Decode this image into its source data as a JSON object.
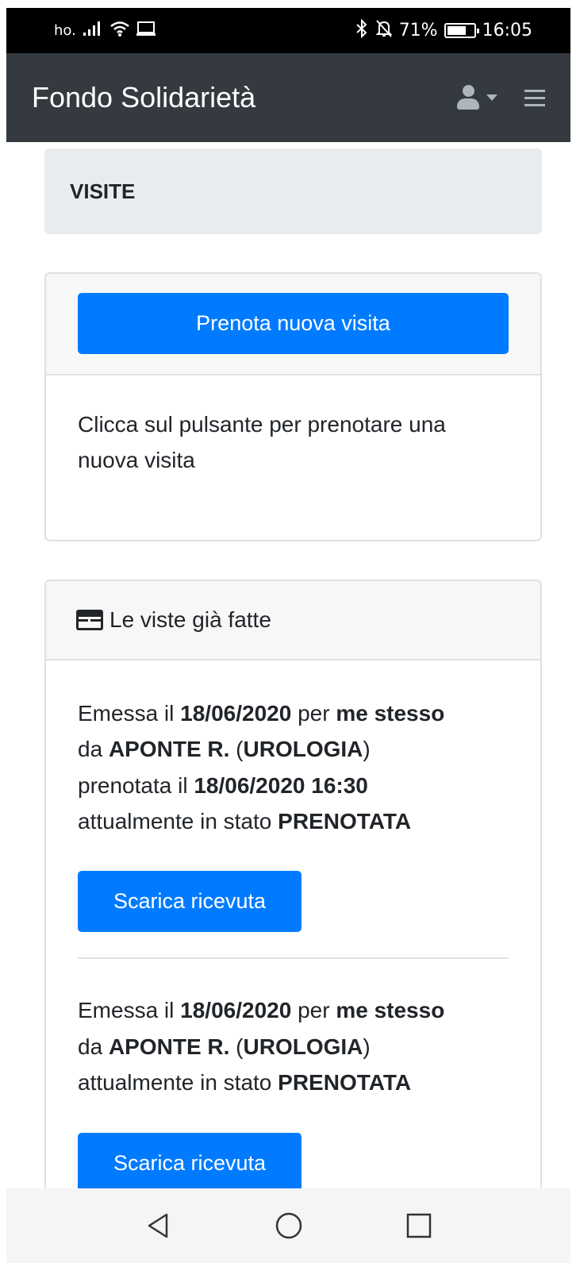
{
  "status_bar": {
    "carrier": "ho.",
    "battery_percent": "71%",
    "battery_level": 0.71,
    "time": "16:05"
  },
  "navbar": {
    "brand": "Fondo Solidarietà"
  },
  "page": {
    "title": "VISITE"
  },
  "booking_card": {
    "button_label": "Prenota nuova visita",
    "description": "Clicca sul pulsante per prenotare una nuova visita"
  },
  "visits_card": {
    "header": "Le viste già fatte",
    "visits": [
      {
        "t1": "Emessa il ",
        "date": "18/06/2020",
        "t2": " per ",
        "for": "me stesso",
        "t3": "da ",
        "doctor": "APONTE R.",
        "t4": " (",
        "specialty": "UROLOGIA",
        "t5": ")",
        "t6": "prenotata il ",
        "booked_at": "18/06/2020 16:30",
        "t7": "attualmente in stato ",
        "status": "PRENOTATA",
        "button_label": "Scarica ricevuta"
      },
      {
        "t1": "Emessa il ",
        "date": "18/06/2020",
        "t2": " per ",
        "for": "me stesso",
        "t3": "da ",
        "doctor": "APONTE R.",
        "t4": " (",
        "specialty": "UROLOGIA",
        "t5": ")",
        "t7": "attualmente in stato ",
        "status": "PRENOTATA",
        "button_label": "Scarica ricevuta"
      }
    ]
  },
  "colors": {
    "primary": "#007bff",
    "navbar": "#343a40",
    "breadcrumb_bg": "#e9ecef",
    "card_header_bg": "#f7f7f7"
  }
}
